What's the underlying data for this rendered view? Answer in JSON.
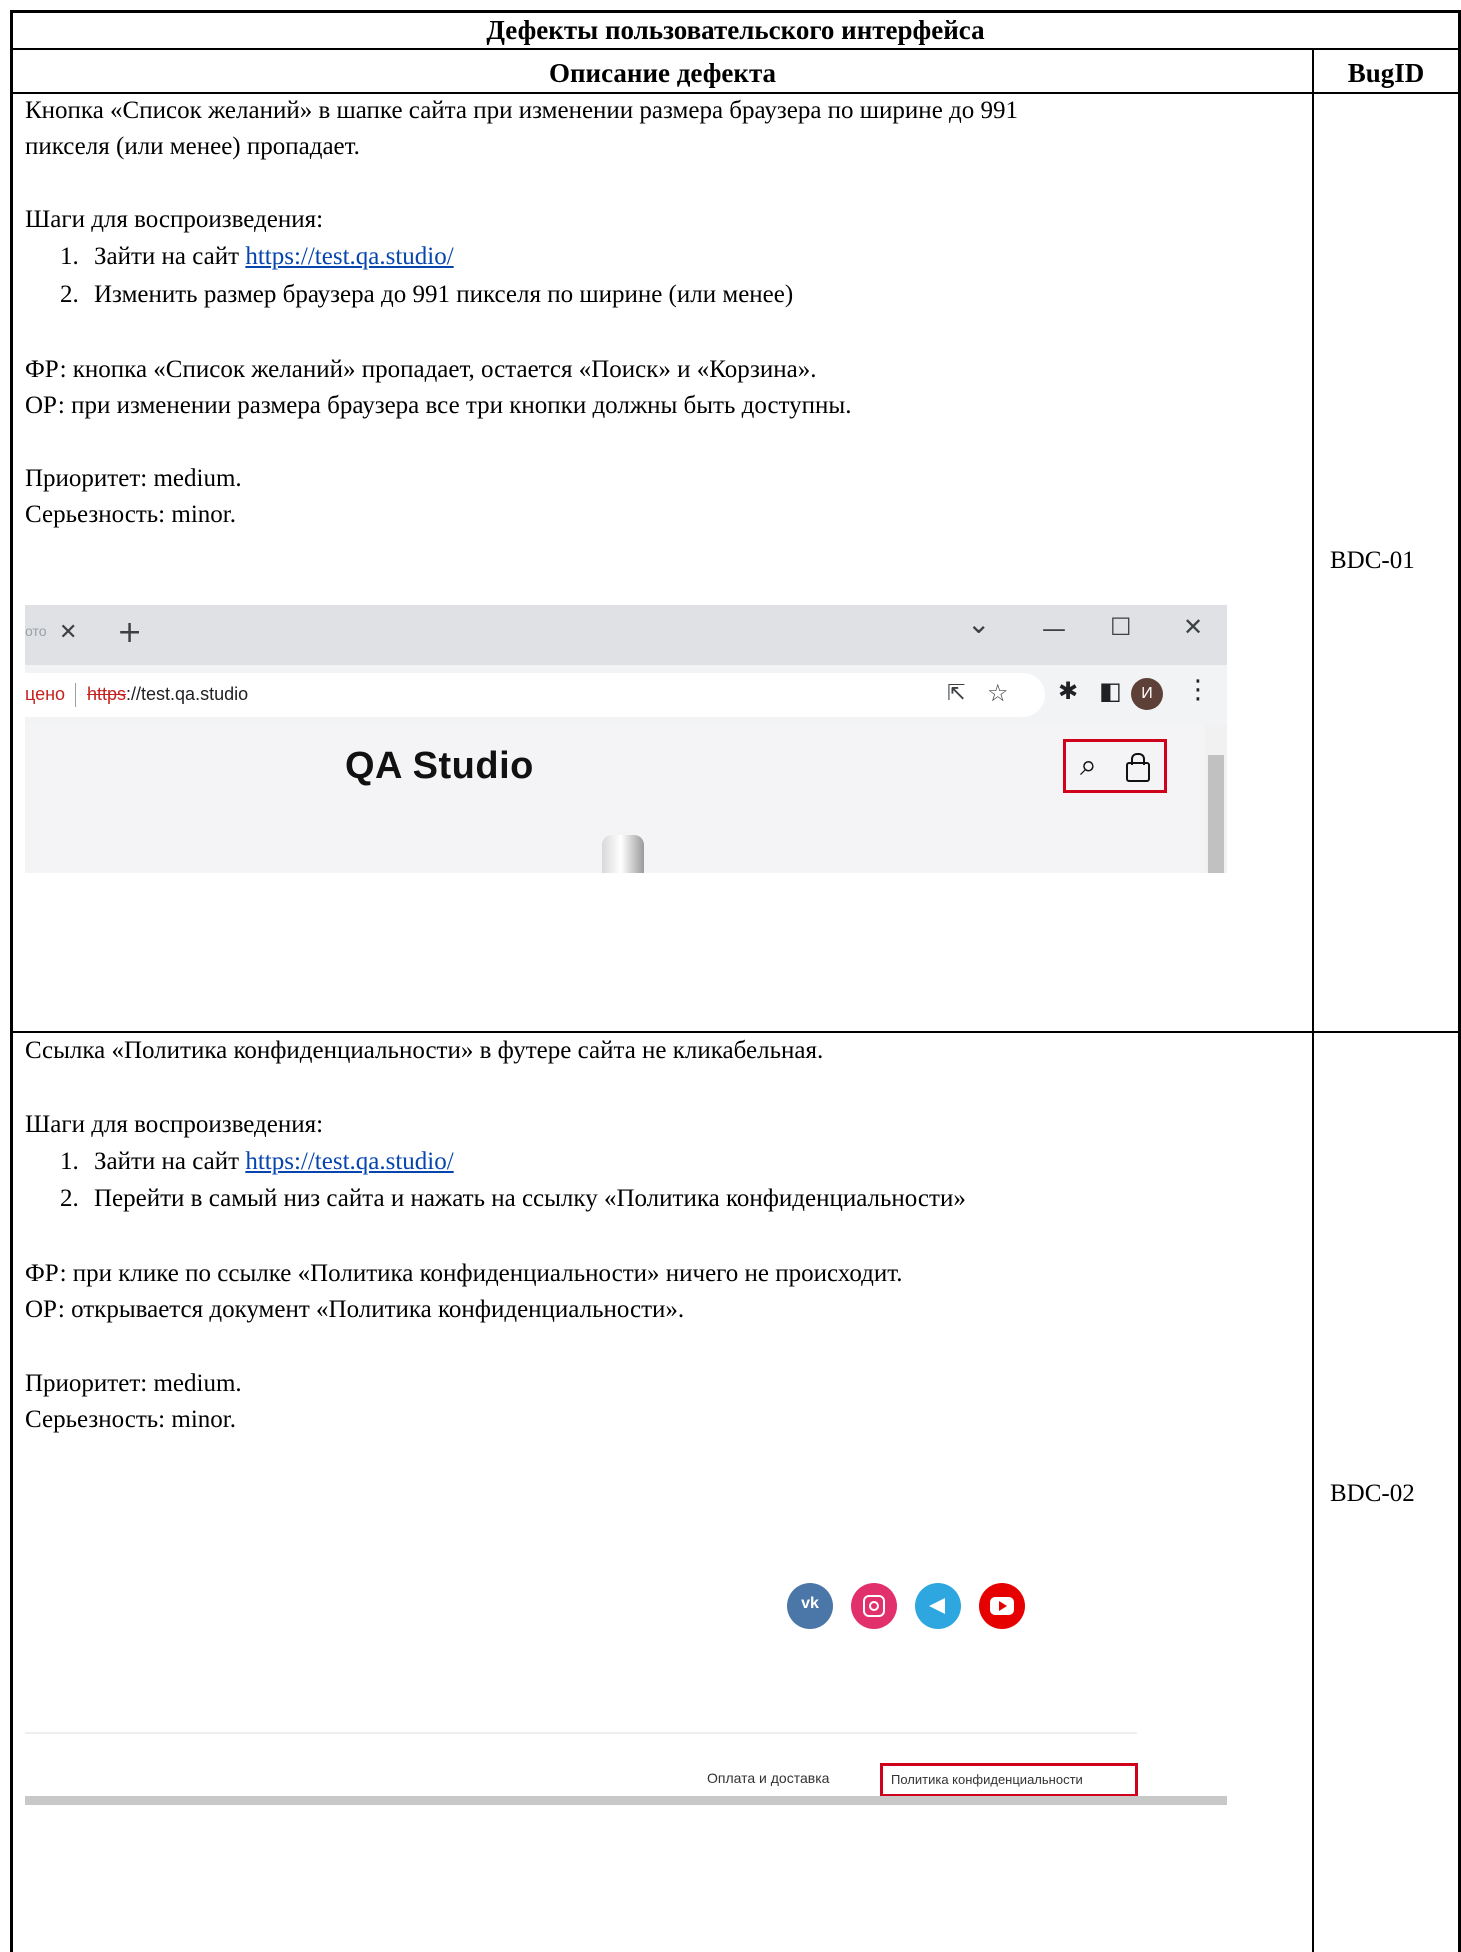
{
  "table": {
    "title": "Дефекты пользовательского интерфейса",
    "col_description": "Описание дефекта",
    "col_bugid": "BugID"
  },
  "bugs": [
    {
      "summary_line1": "Кнопка «Список желаний» в шапке сайта при изменении размера браузера по ширине до 991",
      "summary_line2": "пикселя (или менее) пропадает.",
      "steps_title": "Шаги для воспроизведения:",
      "step1_num": "1.",
      "step1_prefix": "Зайти на сайт ",
      "step1_link": "https://test.qa.studio/",
      "step2_num": "2.",
      "step2_text": "Изменить размер браузера до 991 пикселя по ширине (или менее)",
      "actual": "ФР: кнопка «Список желаний» пропадает, остается «Поиск» и «Корзина».",
      "expected": "ОР: при изменении размера браузера все три кнопки должны быть доступны.",
      "priority": "Приоритет: medium.",
      "severity": "Серьезность: minor.",
      "id": "BDC-01"
    },
    {
      "summary_line1": "Ссылка «Политика конфиденциальности» в футере сайта не кликабельная.",
      "steps_title": "Шаги для воспроизведения:",
      "step1_num": "1.",
      "step1_prefix": "Зайти на сайт ",
      "step1_link": "https://test.qa.studio/",
      "step2_num": "2.",
      "step2_text": "Перейти в самый низ сайта и нажать на ссылку «Политика конфиденциальности»",
      "actual": "ФР: при клике по ссылке «Политика конфиденциальности» ничего не происходит.",
      "expected": "ОР: открывается документ «Политика конфиденциальности».",
      "priority": "Приоритет: medium.",
      "severity": "Серьезность: minor.",
      "id": "BDC-02"
    }
  ],
  "screenshot1": {
    "tab_fragment": "ото",
    "tab_close": "✕",
    "new_tab": "+",
    "caret": "⌄",
    "minimize": "—",
    "maximize": "☐",
    "close": "✕",
    "insecure_fragment": "цено",
    "url_scheme": "https",
    "url_rest": "://test.qa.studio",
    "profile_initial": "И",
    "menu_dots": "⋮",
    "star": "☆",
    "share": "⇱",
    "puzzle": "✱",
    "sidepanel": "◧",
    "site_title": "QA Studio",
    "search_icon": "⌕",
    "bag_icon": "🔒",
    "highlight_color": "#d0021b"
  },
  "screenshot2": {
    "footer_link1": "Оплата и доставка",
    "footer_link2": "Политика конфиденциальности",
    "vk_label": "vk",
    "highlight_color": "#d0021b",
    "social_colors": {
      "vk": "#4a76a8",
      "instagram": "#e1306c",
      "telegram": "#2ea6df",
      "youtube": "#e60000"
    }
  }
}
